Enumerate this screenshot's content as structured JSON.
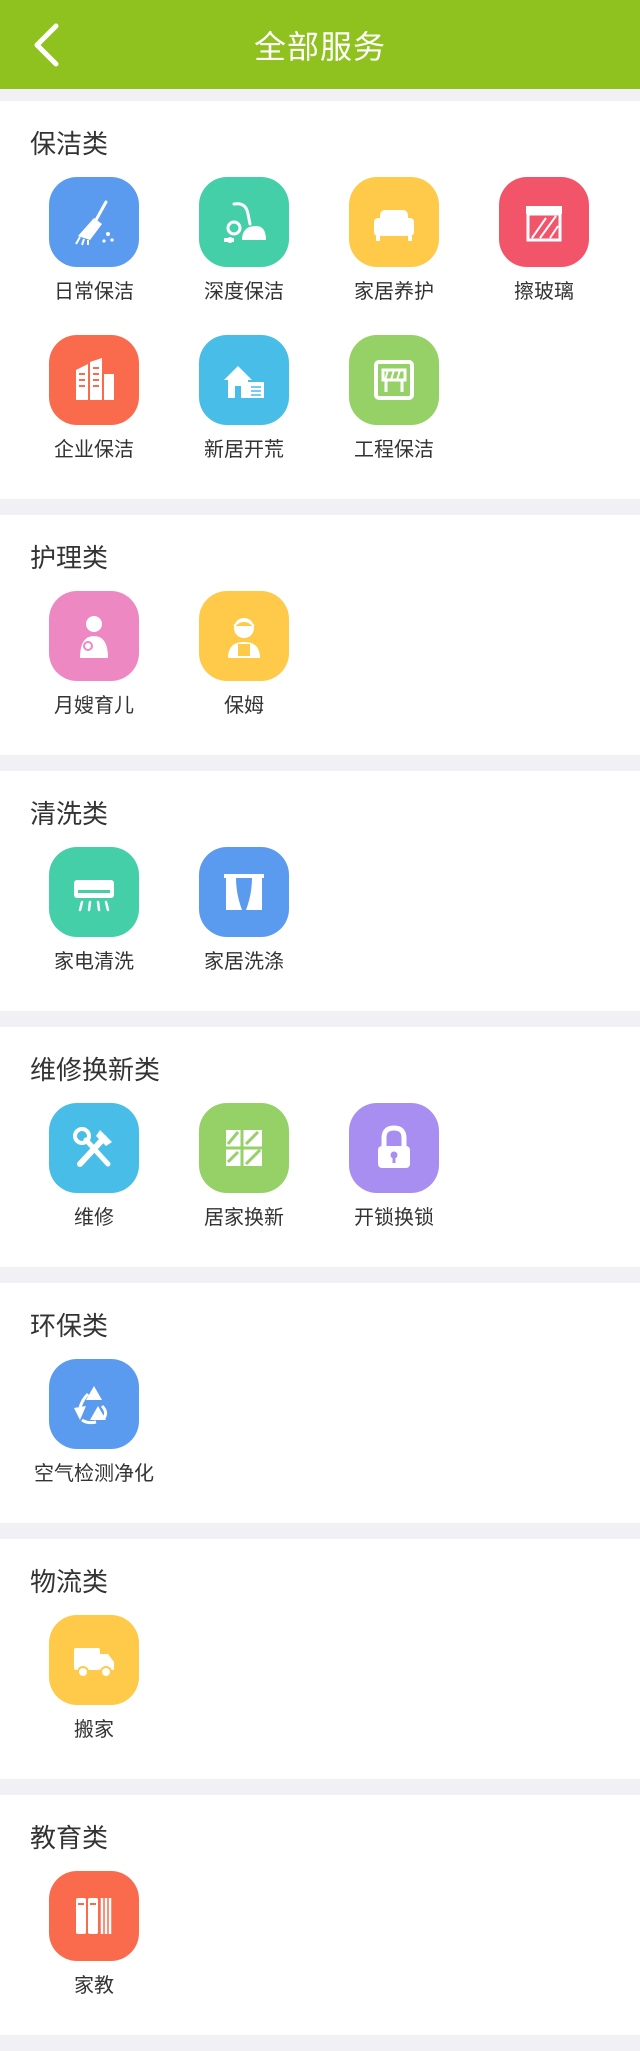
{
  "header": {
    "title": "全部服务",
    "back_icon": "chevron-left-icon"
  },
  "colors": {
    "header_bg": "#8fc21f"
  },
  "sections": [
    {
      "title": "保洁类",
      "items": [
        {
          "label": "日常保洁",
          "icon": "broom-icon",
          "color": "#5b9bef"
        },
        {
          "label": "深度保洁",
          "icon": "vacuum-icon",
          "color": "#45cfa8"
        },
        {
          "label": "家居养护",
          "icon": "sofa-icon",
          "color": "#ffca4a"
        },
        {
          "label": "擦玻璃",
          "icon": "window-icon",
          "color": "#f2546a"
        },
        {
          "label": "企业保洁",
          "icon": "building-icon",
          "color": "#fa6b4e"
        },
        {
          "label": "新居开荒",
          "icon": "house-icon",
          "color": "#47bde8"
        },
        {
          "label": "工程保洁",
          "icon": "construction-icon",
          "color": "#95d166"
        }
      ]
    },
    {
      "title": "护理类",
      "items": [
        {
          "label": "月嫂育儿",
          "icon": "mother-baby-icon",
          "color": "#ee88c2"
        },
        {
          "label": "保姆",
          "icon": "nanny-icon",
          "color": "#ffca4a"
        }
      ]
    },
    {
      "title": "清洗类",
      "items": [
        {
          "label": "家电清洗",
          "icon": "air-conditioner-icon",
          "color": "#45cfa8"
        },
        {
          "label": "家居洗涤",
          "icon": "curtain-icon",
          "color": "#5b9bef"
        }
      ]
    },
    {
      "title": "维修换新类",
      "items": [
        {
          "label": "维修",
          "icon": "tools-icon",
          "color": "#47bde8"
        },
        {
          "label": "居家换新",
          "icon": "glass-pane-icon",
          "color": "#95d166"
        },
        {
          "label": "开锁换锁",
          "icon": "lock-icon",
          "color": "#a88ef0"
        }
      ]
    },
    {
      "title": "环保类",
      "items": [
        {
          "label": "空气检测净化",
          "icon": "recycle-icon",
          "color": "#5b9bef"
        }
      ]
    },
    {
      "title": "物流类",
      "items": [
        {
          "label": "搬家",
          "icon": "truck-icon",
          "color": "#ffca4a"
        }
      ]
    },
    {
      "title": "教育类",
      "items": [
        {
          "label": "家教",
          "icon": "books-icon",
          "color": "#fa6b4e"
        }
      ]
    }
  ]
}
